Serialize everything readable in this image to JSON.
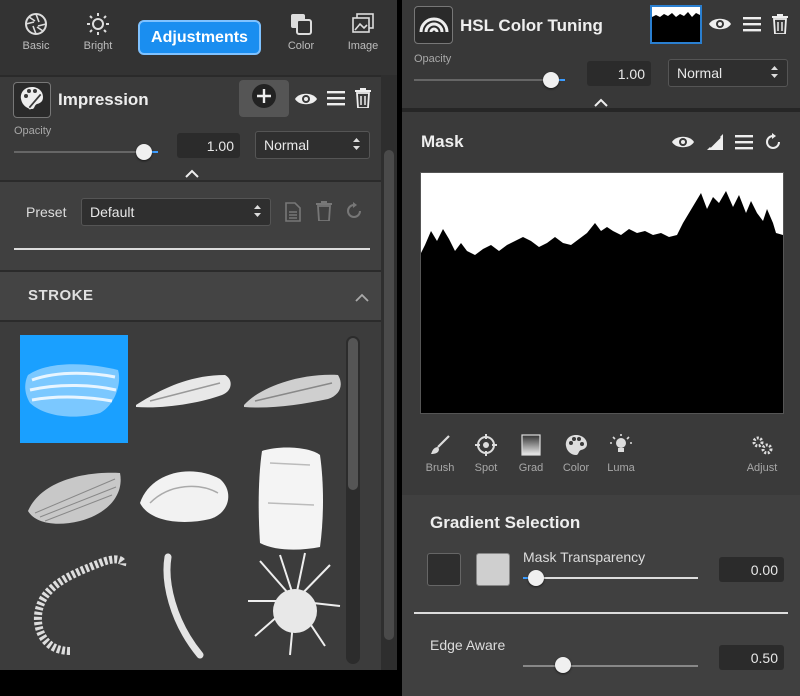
{
  "left": {
    "toolbar": {
      "items": [
        {
          "label": "Basic",
          "icon": "aperture-icon"
        },
        {
          "label": "Bright",
          "icon": "sun-icon"
        },
        {
          "label": "Color",
          "icon": "layers-icon"
        },
        {
          "label": "Image",
          "icon": "image-icon"
        }
      ],
      "active": "Adjustments"
    },
    "layer": {
      "title": "Impression",
      "opacity_label": "Opacity",
      "opacity_value": "1.00",
      "opacity_level": 1.0,
      "blend_mode": "Normal"
    },
    "preset": {
      "label": "Preset",
      "value": "Default"
    },
    "stroke": {
      "title": "STROKE"
    }
  },
  "right": {
    "layer": {
      "title": "HSL Color Tuning",
      "opacity_label": "Opacity",
      "opacity_value": "1.00",
      "opacity_level": 1.0,
      "blend_mode": "Normal"
    },
    "mask": {
      "title": "Mask",
      "tools": [
        {
          "label": "Brush",
          "icon": "brush-icon"
        },
        {
          "label": "Spot",
          "icon": "target-icon"
        },
        {
          "label": "Grad",
          "icon": "gradient-icon"
        },
        {
          "label": "Color",
          "icon": "palette-icon"
        },
        {
          "label": "Luma",
          "icon": "bulb-icon"
        },
        {
          "label": "Adjust",
          "icon": "gears-icon"
        }
      ]
    },
    "gradient": {
      "title": "Gradient Selection",
      "transparency_label": "Mask Transparency",
      "transparency_value": "0.00",
      "transparency_level": 0.0
    },
    "edge": {
      "label": "Edge Aware",
      "value": "0.50",
      "level": 0.5
    }
  },
  "colors": {
    "accent": "#1a8ef0",
    "panel": "#3a3a3a",
    "selected_brush": "#1aa0ff"
  }
}
